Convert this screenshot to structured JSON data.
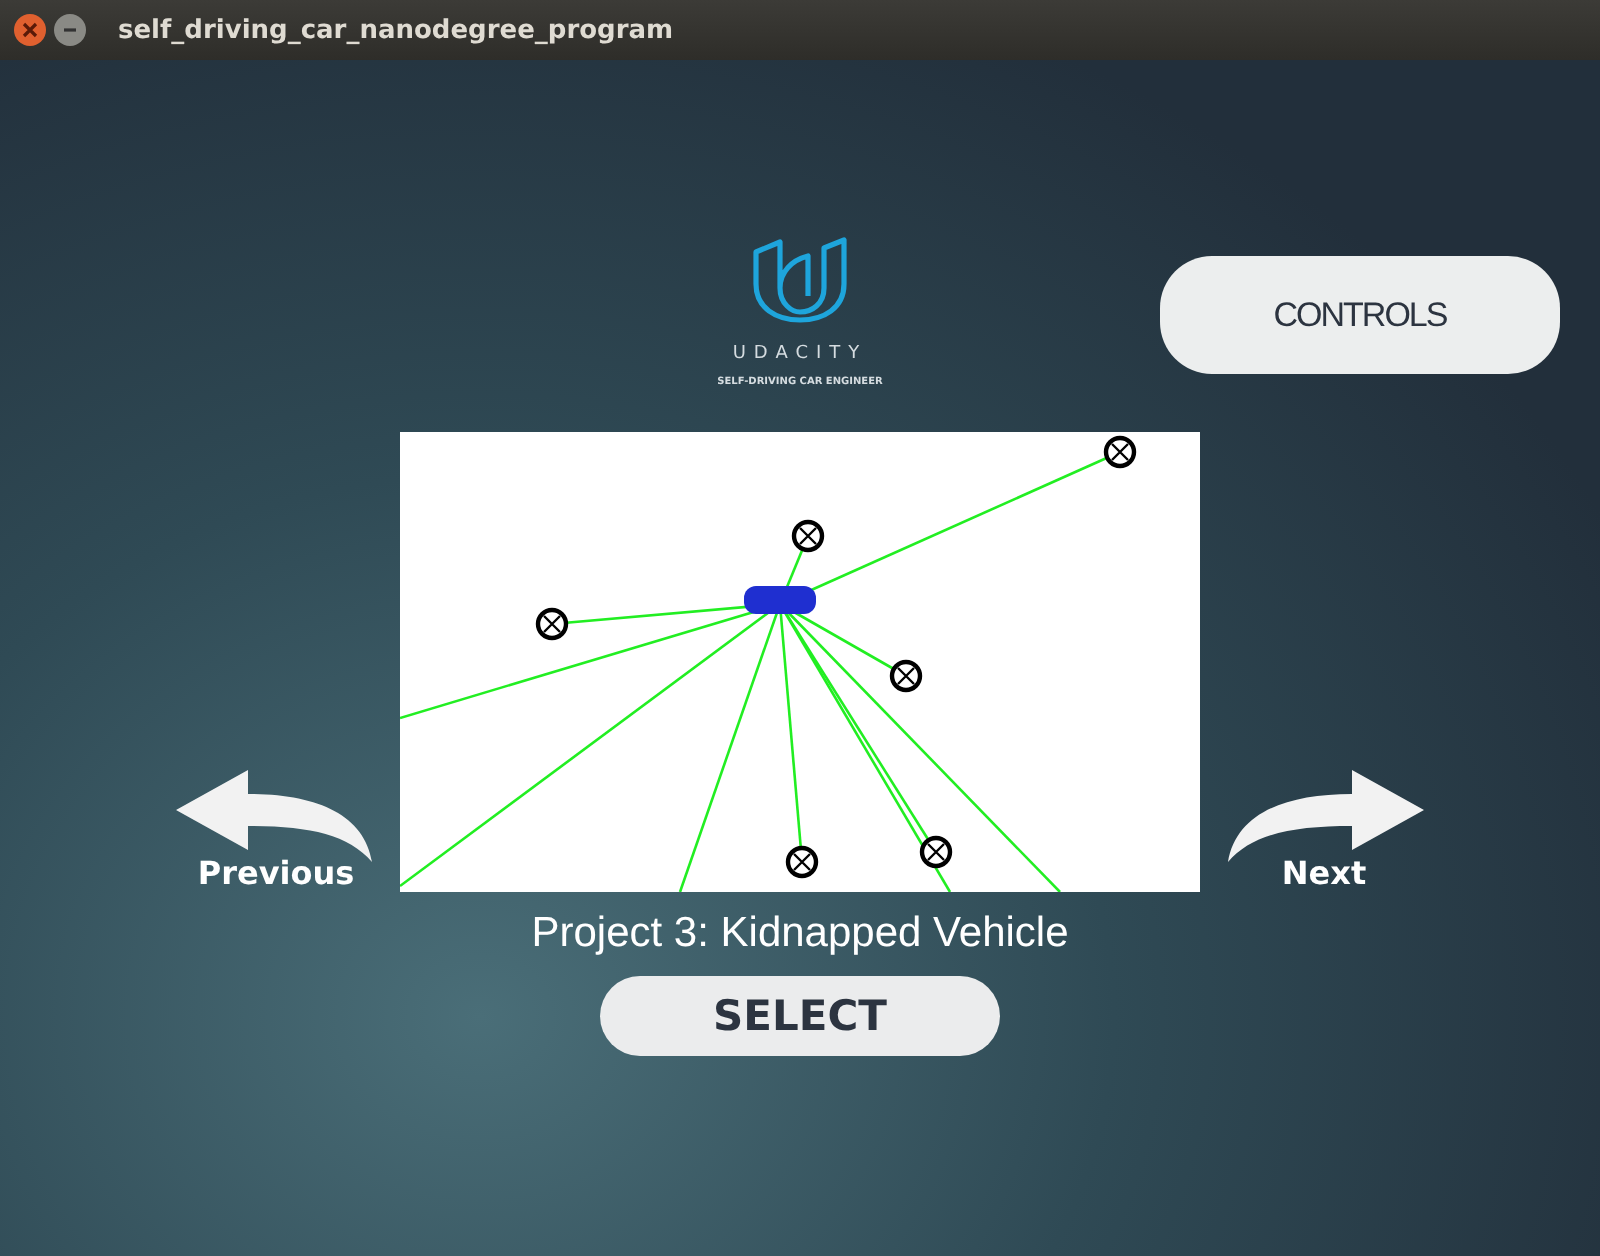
{
  "window": {
    "title": "self_driving_car_nanodegree_program"
  },
  "logo": {
    "wordmark": "UDACITY",
    "tagline": "SELF-DRIVING CAR ENGINEER"
  },
  "controls_button": "CONTROLS",
  "previous": {
    "label": "Previous"
  },
  "next": {
    "label": "Next"
  },
  "project_title": "Project 3: Kidnapped Vehicle",
  "select_button": "SELECT"
}
